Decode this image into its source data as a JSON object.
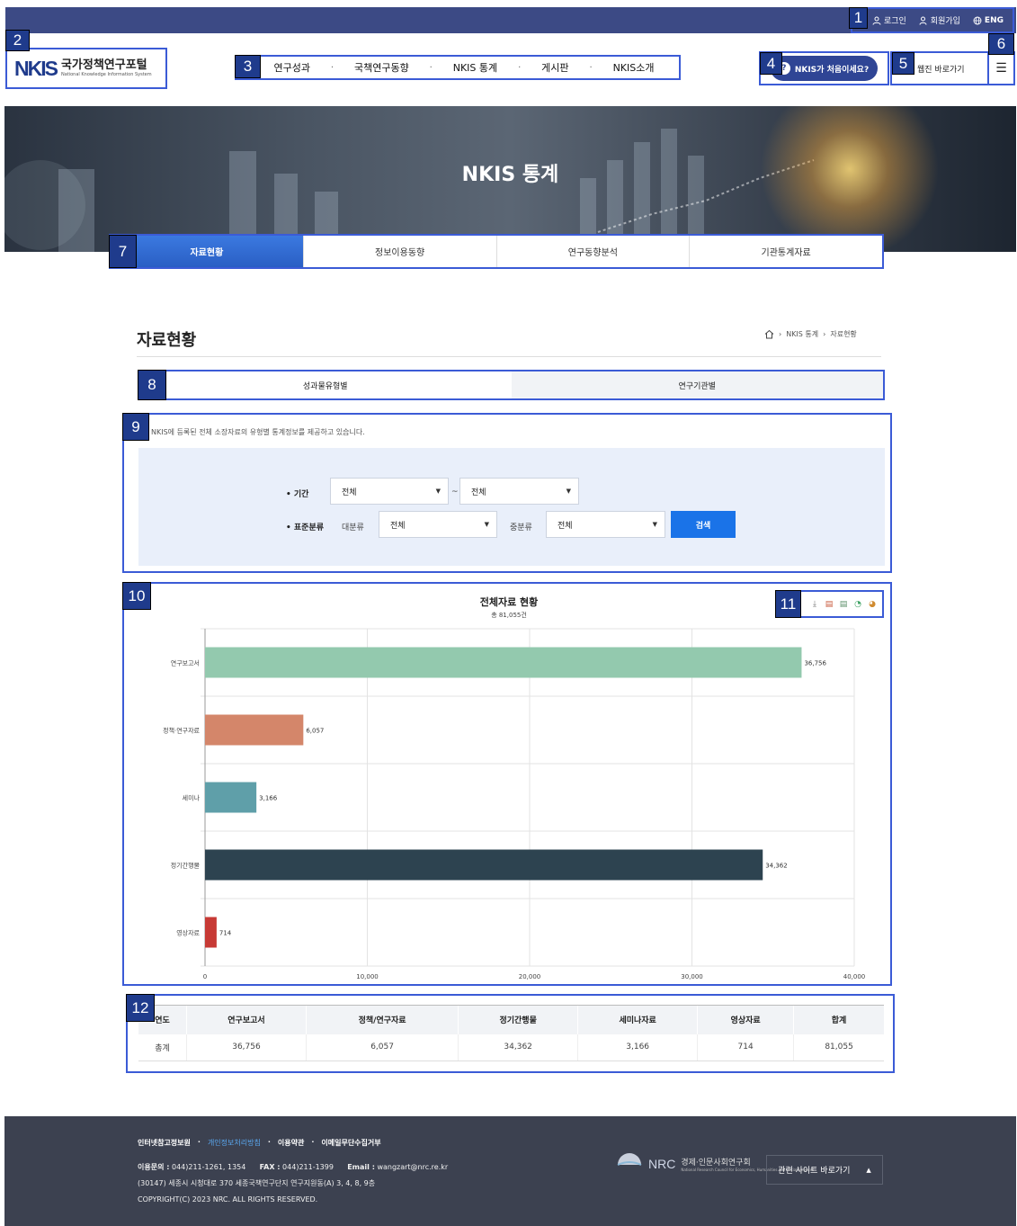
{
  "topbar": {
    "login": "로그인",
    "signup": "회원가입",
    "lang": "ENG"
  },
  "logo": {
    "mark": "NKIS",
    "title": "국가정책연구포털",
    "subtitle": "National Knowledge Information System"
  },
  "gnb": [
    "연구성과",
    "국책연구동향",
    "NKIS 통계",
    "게시판",
    "NKIS소개"
  ],
  "header": {
    "intro_button": "NKIS가 처음이세요?",
    "webzine": "웹진 바로가기",
    "menu_icon": "☰"
  },
  "hero": {
    "title": "NKIS 통계"
  },
  "subtabs": [
    "자료현황",
    "정보이용동향",
    "연구동향분석",
    "기관통계자료"
  ],
  "page": {
    "title": "자료현황",
    "breadcrumb": [
      "NKIS 통계",
      "자료현황"
    ]
  },
  "type_tabs": [
    "성과물유형별",
    "연구기관별"
  ],
  "filter": {
    "description": "NKIS에 등록된 전체 소장자료의 유형별 통계정보를 제공하고 있습니다.",
    "period_label": "• 기간",
    "period_from": "전체",
    "period_tilde": "~",
    "period_to": "전체",
    "std_label": "• 표준분류",
    "major_label": "대분류",
    "major_value": "전체",
    "minor_label": "중분류",
    "minor_value": "전체",
    "search_button": "검색"
  },
  "tags": [
    "1",
    "2",
    "3",
    "4",
    "5",
    "6",
    "7",
    "8",
    "9",
    "10",
    "11",
    "12"
  ],
  "chart_data": {
    "type": "bar",
    "orientation": "horizontal",
    "title": "전체자료 현황",
    "subtitle": "총 81,055건",
    "categories": [
      "연구보고서",
      "정책·연구자료",
      "세미나",
      "정기간행물",
      "영상자료"
    ],
    "values": [
      36756,
      6057,
      3166,
      34362,
      714
    ],
    "value_labels": [
      "36,756",
      "6,057",
      "3,166",
      "34,362",
      "714"
    ],
    "colors": [
      "#93c9ae",
      "#d4866a",
      "#5f9fa9",
      "#2d4350",
      "#c73a35"
    ],
    "xlim": [
      0,
      40000
    ],
    "xticks": [
      0,
      10000,
      20000,
      30000,
      40000
    ],
    "xtick_labels": [
      "0",
      "10,000",
      "20,000",
      "30,000",
      "40,000"
    ],
    "grid": true
  },
  "table": {
    "headers": [
      "연도",
      "연구보고서",
      "정책/연구자료",
      "정기간행물",
      "세미나자료",
      "영상자료",
      "합계"
    ],
    "rows": [
      [
        "총계",
        "36,756",
        "6,057",
        "34,362",
        "3,166",
        "714",
        "81,055"
      ]
    ]
  },
  "footer": {
    "links": [
      "인터넷참고정보원",
      "개인정보처리방침",
      "이용약관",
      "이메일무단수집거부"
    ],
    "phone_label": "이용문의 :",
    "phone": "044)211-1261, 1354",
    "fax_label": "FAX :",
    "fax": "044)211-1399",
    "email_label": "Email :",
    "email": "wangzart@nrc.re.kr",
    "address": "(30147) 세종시 시청대로 370 세종국책연구단지 연구지원동(A) 3, 4, 8, 9층",
    "copyright": "COPYRIGHT(C) 2023 NRC. ALL RIGHTS RESERVED.",
    "nrc_mark": "NRC",
    "nrc_name": "경제·인문사회연구회",
    "nrc_sub": "National Research Council for Economics, Humanities and Social Sciences",
    "related": "관련 사이트 바로가기",
    "related_arrow": "▲"
  }
}
